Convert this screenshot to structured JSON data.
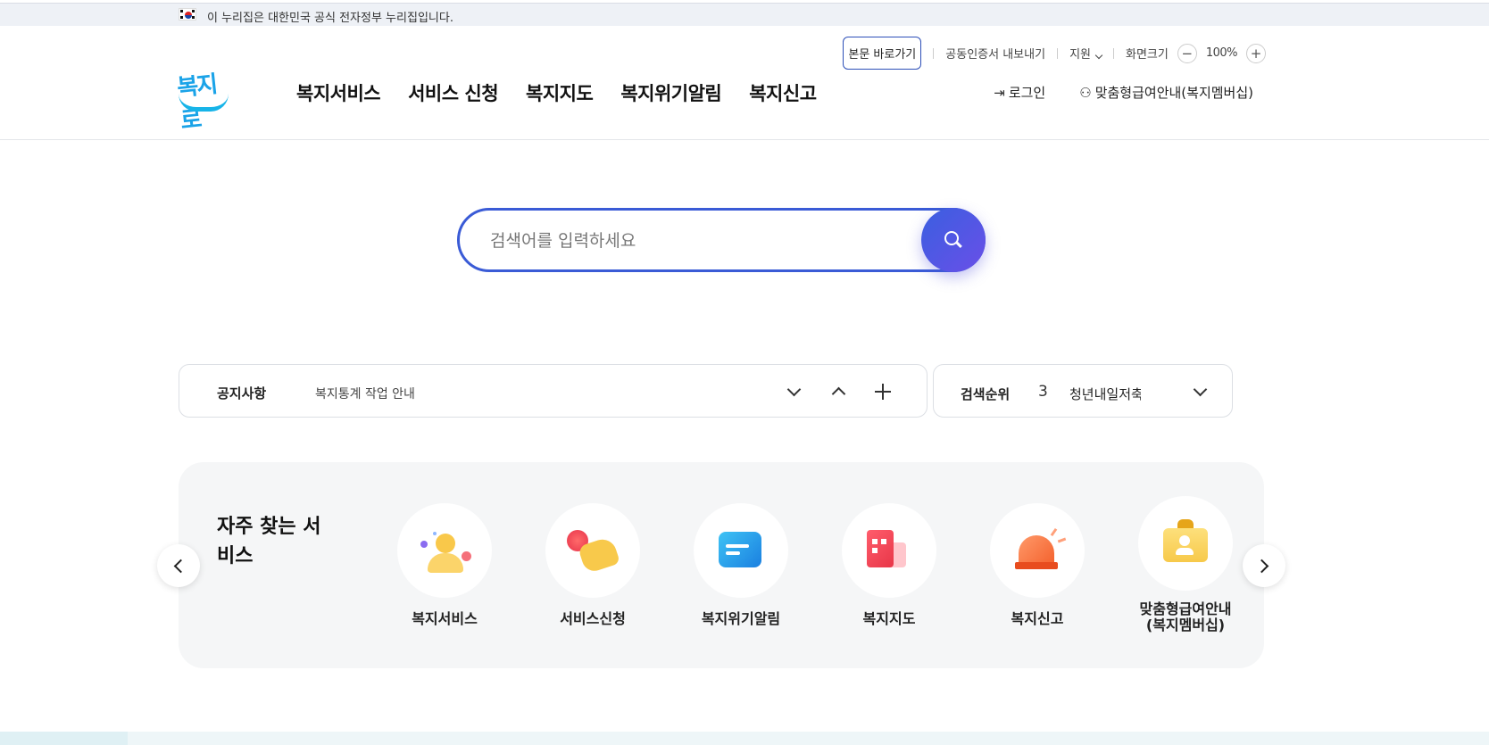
{
  "gov_banner": {
    "text": "이 누리집은 대한민국 공식 전자정부 누리집입니다."
  },
  "utility": {
    "skip_link": "본문 바로가기",
    "cert_export": "공동인증서 내보내기",
    "support": "지원",
    "zoom_label": "화면크기",
    "zoom_minus": "−",
    "zoom_value": "100%",
    "zoom_plus": "+"
  },
  "logo": {
    "text": "복지로"
  },
  "gnb": [
    "복지서비스",
    "서비스 신청",
    "복지지도",
    "복지위기알림",
    "복지신고"
  ],
  "member": {
    "login": "로그인",
    "custom_guide": "맞춤형급여안내(복지멤버십)"
  },
  "search": {
    "placeholder": "검색어를 입력하세요",
    "value": ""
  },
  "notice": {
    "label": "공지사항",
    "text": "복지통계 작업 안내"
  },
  "rank": {
    "label": "검색순위",
    "number": "3",
    "term": "청년내일저축"
  },
  "favorites": {
    "title": "자주 찾는 서비스",
    "items": [
      {
        "name": "복지서비스",
        "icon": "person-icon"
      },
      {
        "name": "서비스신청",
        "icon": "touch-icon"
      },
      {
        "name": "복지위기알림",
        "icon": "chat-icon"
      },
      {
        "name": "복지지도",
        "icon": "building-map-icon"
      },
      {
        "name": "복지신고",
        "icon": "siren-icon"
      },
      {
        "name": "맞춤형급여안내\n(복지멤버십)",
        "icon": "id-card-icon"
      }
    ]
  },
  "colors": {
    "accent": "#3a5bd6",
    "logo": "#1aa3e8",
    "panel": "#f5f6f7"
  }
}
